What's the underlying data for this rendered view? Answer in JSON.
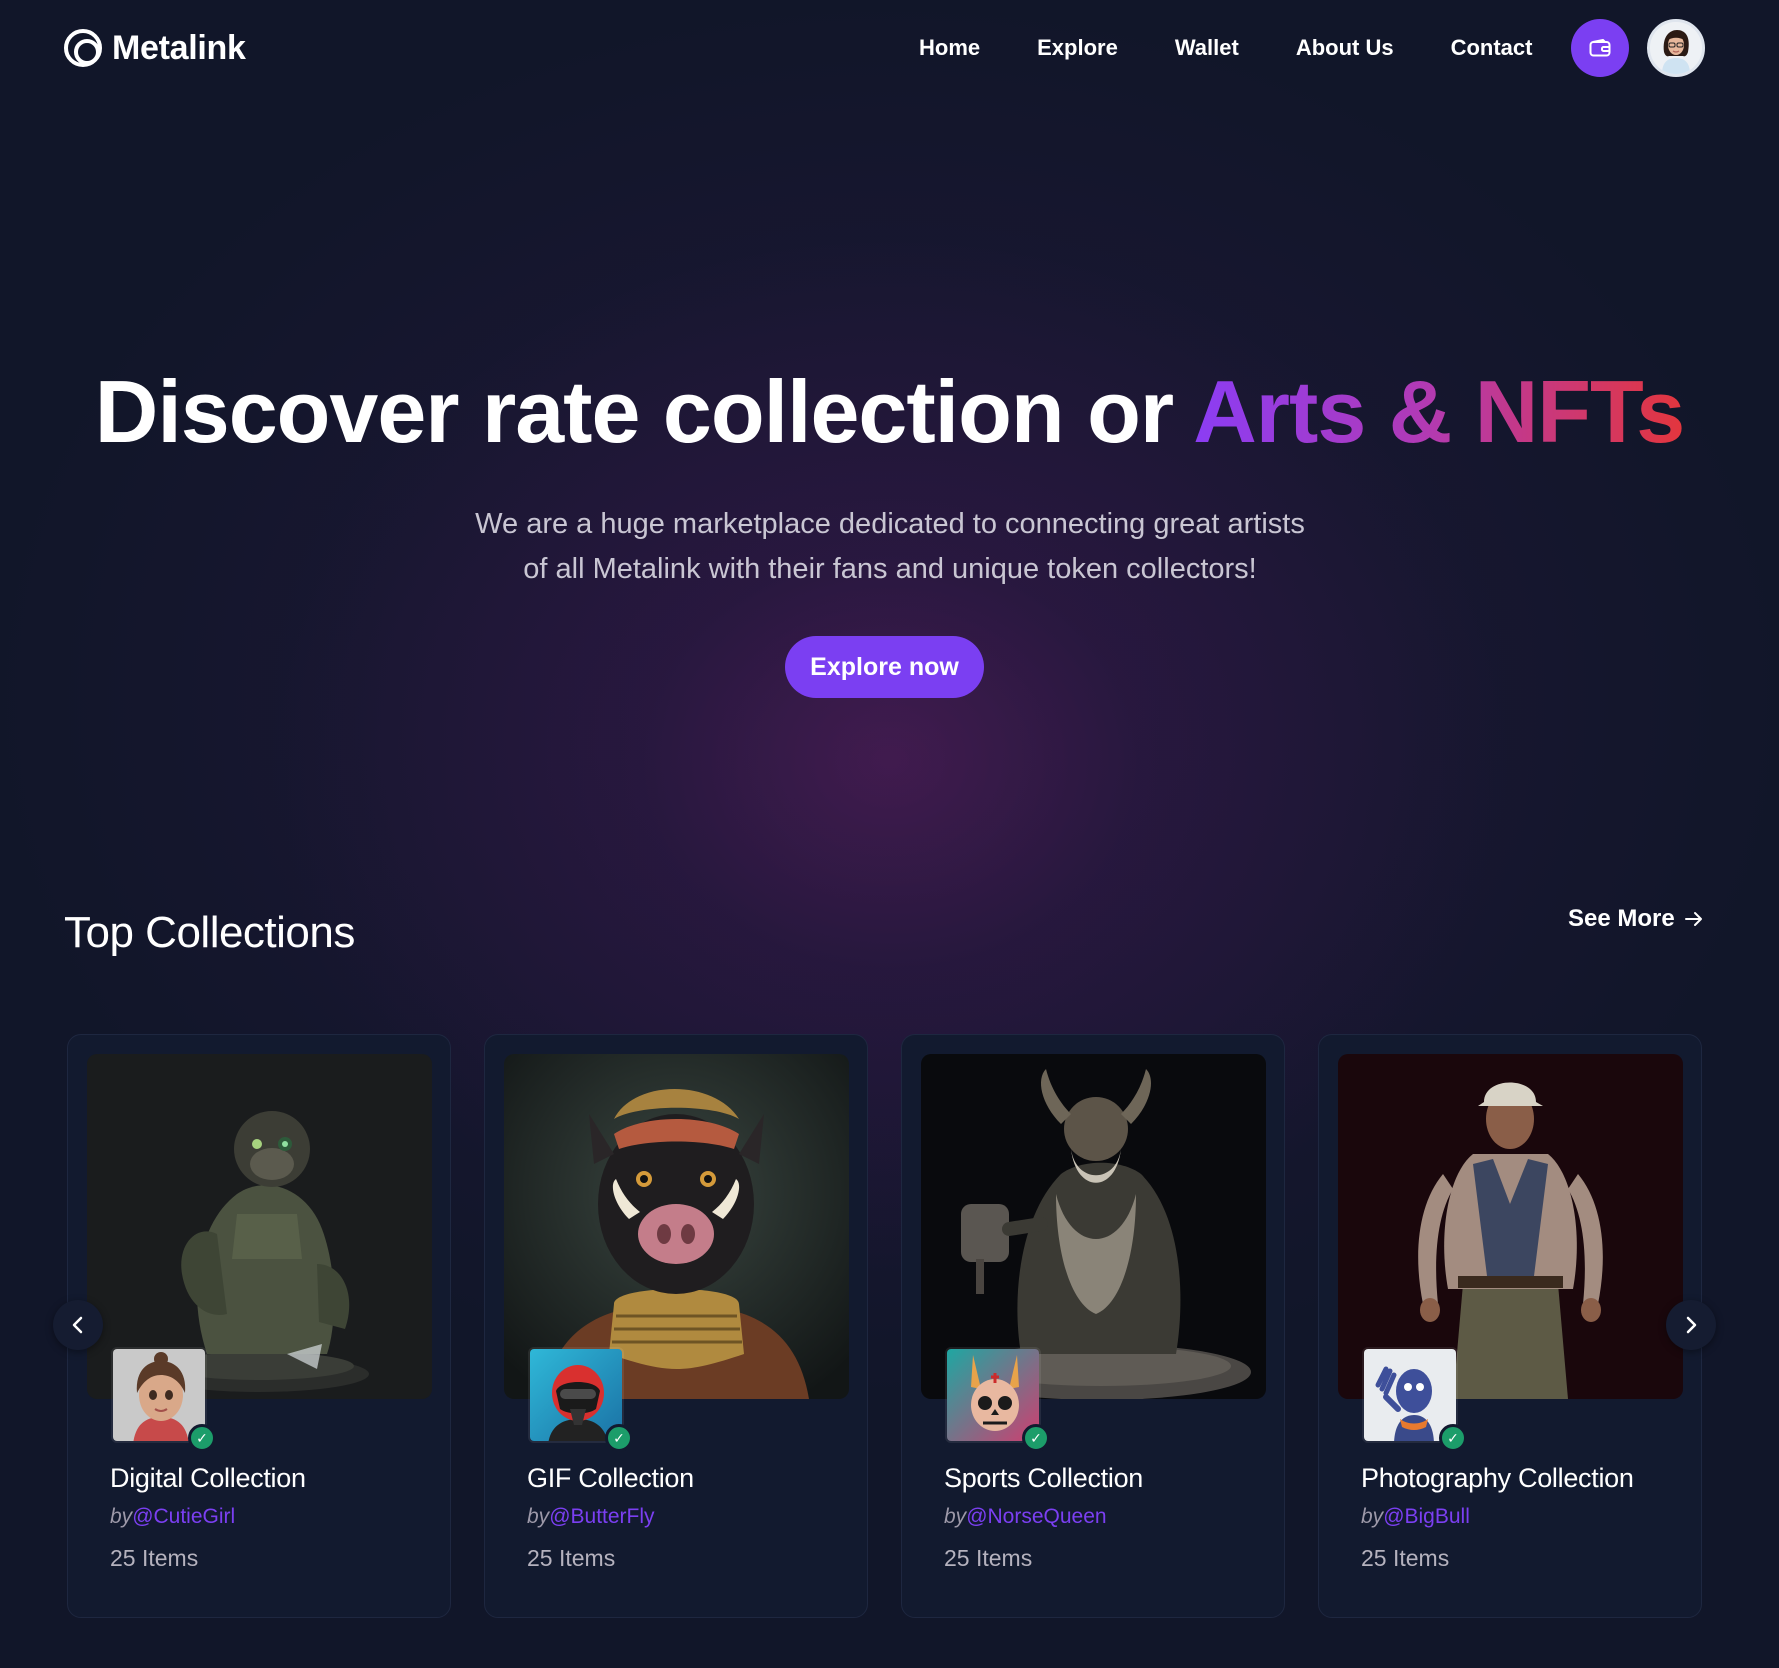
{
  "brand": {
    "name": "Metalink",
    "logo_icon": "ring-logo-icon"
  },
  "nav": {
    "items": [
      "Home",
      "Explore",
      "Wallet",
      "About Us",
      "Contact"
    ]
  },
  "header": {
    "wallet_icon": "wallet-icon",
    "avatar_icon": "user-avatar"
  },
  "hero": {
    "title_main": "Discover rate collection or ",
    "title_highlight": "Arts & NFTs",
    "subtitle_line1": "We are a huge marketplace dedicated to connecting great artists",
    "subtitle_line2": "of all Metalink with their fans and unique token collectors!",
    "cta": "Explore now"
  },
  "collections": {
    "title": "Top Collections",
    "see_more": "See More",
    "cards": [
      {
        "title": "Digital Collection",
        "by": "by",
        "handle": "@CutieGirl",
        "items": "25 Items"
      },
      {
        "title": "GIF Collection",
        "by": "by",
        "handle": "@ButterFly",
        "items": "25 Items"
      },
      {
        "title": "Sports Collection",
        "by": "by",
        "handle": "@NorseQueen",
        "items": "25 Items"
      },
      {
        "title": "Photography Collection",
        "by": "by",
        "handle": "@BigBull",
        "items": "25 Items"
      }
    ]
  },
  "colors": {
    "background": "#111629",
    "accent": "#7b3ff2",
    "gradient_start": "#8b3df4",
    "gradient_end": "#e3363d",
    "verified": "#1c9d6a"
  }
}
